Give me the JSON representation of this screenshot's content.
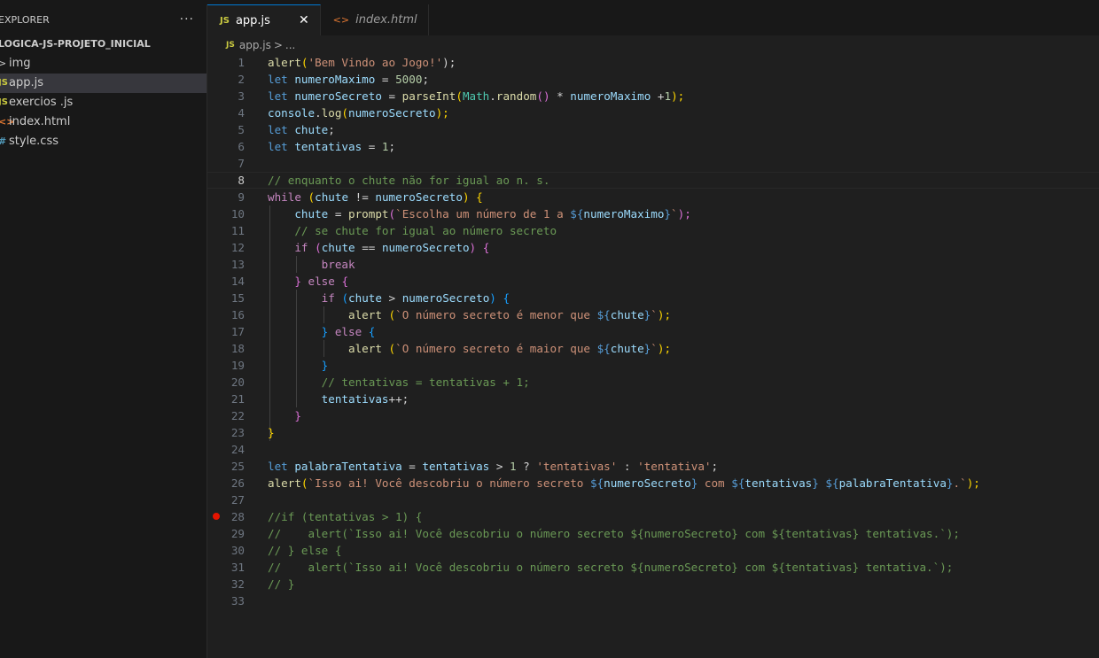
{
  "sidebar": {
    "title": "EXPLORER",
    "more": "···",
    "folder": "LOGICA-JS-PROJETO_INICIAL",
    "items": [
      {
        "icon": ">",
        "label": "img"
      },
      {
        "icon": "JS",
        "label": "app.js"
      },
      {
        "icon": "JS",
        "label": "exercios .js"
      },
      {
        "icon": "<>",
        "label": "index.html"
      },
      {
        "icon": "#",
        "label": "style.css"
      }
    ]
  },
  "tabs": [
    {
      "icon": "JS",
      "label": "app.js",
      "close": "✕"
    },
    {
      "icon": "<>",
      "label": "index.html"
    }
  ],
  "breadcrumb": {
    "icon": "JS",
    "file": "app.js",
    "sep": ">",
    "rest": "..."
  },
  "editor": {
    "line_numbers": [
      "1",
      "2",
      "3",
      "4",
      "5",
      "6",
      "7",
      "8",
      "9",
      "10",
      "11",
      "12",
      "13",
      "14",
      "15",
      "16",
      "17",
      "18",
      "19",
      "20",
      "21",
      "22",
      "23",
      "24",
      "25",
      "26",
      "27",
      "28",
      "29",
      "30",
      "31",
      "32",
      "33"
    ],
    "current_line": 8,
    "breakpoint_line": 28,
    "tokens": {
      "l1": [
        "alert",
        "(",
        "'Bem Vindo ao Jogo!'",
        ");"
      ],
      "l2": [
        "let",
        " ",
        "numeroMaximo",
        " = ",
        "5000",
        ";"
      ],
      "l3": [
        "let",
        " ",
        "numeroSecreto",
        " = ",
        "parseInt",
        "(",
        "Math",
        ".",
        "random",
        "()",
        " * ",
        "numeroMaximo",
        " +",
        "1",
        ");"
      ],
      "l4": [
        "console",
        ".",
        "log",
        "(",
        "numeroSecreto",
        ");"
      ],
      "l5": [
        "let",
        " ",
        "chute",
        ";"
      ],
      "l6": [
        "let",
        " ",
        "tentativas",
        " = ",
        "1",
        ";"
      ],
      "l8": [
        "// enquanto o chute não for igual ao n. s."
      ],
      "l9": [
        "while",
        " ",
        "(",
        "chute",
        " != ",
        "numeroSecreto",
        ")",
        " ",
        "{"
      ],
      "l10": [
        "chute",
        " = ",
        "prompt",
        "(",
        "`Escolha um número de 1 a ",
        "${",
        "numeroMaximo",
        "}",
        "`",
        ");"
      ],
      "l11": [
        "// se chute for igual ao número secreto"
      ],
      "l12": [
        "if",
        " ",
        "(",
        "chute",
        " == ",
        "numeroSecreto",
        ")",
        " ",
        "{"
      ],
      "l13": [
        "break"
      ],
      "l14": [
        "}",
        " else ",
        "{"
      ],
      "l15": [
        "if",
        " ",
        "(",
        "chute",
        " > ",
        "numeroSecreto",
        ")",
        " ",
        "{"
      ],
      "l16": [
        "alert",
        " ",
        "(",
        "`O número secreto é menor que ",
        "${",
        "chute",
        "}",
        "`",
        ");"
      ],
      "l17": [
        "}",
        " else ",
        "{"
      ],
      "l18": [
        "alert",
        " ",
        "(",
        "`O número secreto é maior que ",
        "${",
        "chute",
        "}",
        "`",
        ");"
      ],
      "l19": [
        "}"
      ],
      "l20": [
        "// tentativas = tentativas + 1;"
      ],
      "l21": [
        "tentativas",
        "++;"
      ],
      "l22": [
        "}"
      ],
      "l23": [
        "}"
      ],
      "l25": [
        "let",
        " ",
        "palabraTentativa",
        " = ",
        "tentativas",
        " > ",
        "1",
        " ? ",
        "'tentativas'",
        " : ",
        "'tentativa'",
        ";"
      ],
      "l26": [
        "alert",
        "(",
        "`Isso ai! Você descobriu o número secreto ",
        "${",
        "numeroSecreto",
        "}",
        " com ",
        "${",
        "tentativas",
        "}",
        " ",
        "${",
        "palabraTentativa",
        "}",
        ".`",
        ");"
      ],
      "l28": [
        "//if (tentativas > 1) {"
      ],
      "l29": [
        "//    alert(`Isso ai! Você descobriu o número secreto ${numeroSecreto} com ${tentativas} tentativas.`);"
      ],
      "l30": [
        "// } else {"
      ],
      "l31": [
        "//    alert(`Isso ai! Você descobriu o número secreto ${numeroSecreto} com ${tentativas} tentativa.`);"
      ],
      "l32": [
        "// }"
      ]
    },
    "colors": {
      "background": "#1f1f1f",
      "keyword": "#569cd6",
      "control": "#c586c0",
      "function": "#dcdcaa",
      "variable": "#9cdcfe",
      "string": "#ce9178",
      "number": "#b5cea8",
      "comment": "#6a9955",
      "breakpoint": "#e51400",
      "active_tab_border": "#0078d4"
    }
  }
}
